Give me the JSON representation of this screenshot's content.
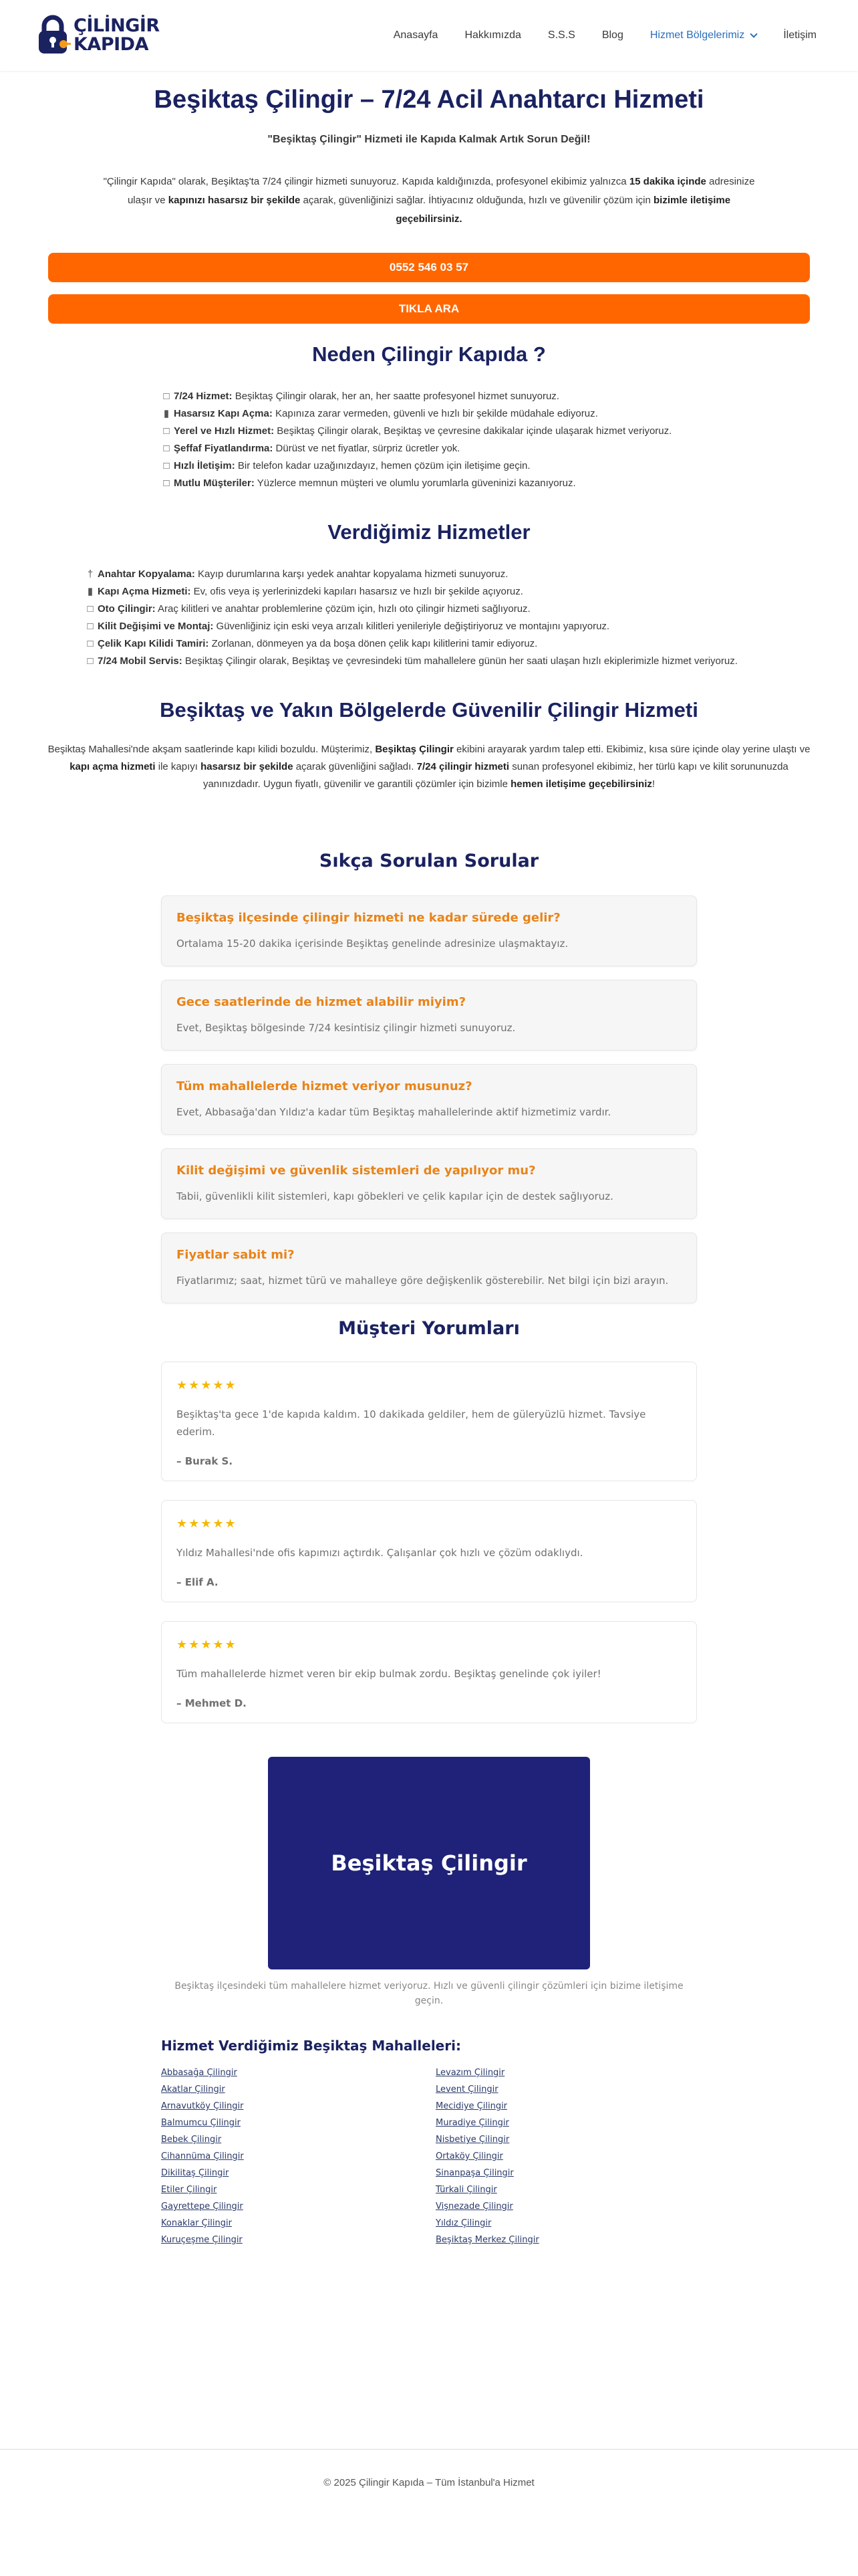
{
  "header": {
    "logo_line1": "ÇİLİNGİR",
    "logo_line2": "KAPIDA",
    "nav": [
      {
        "label": "Anasayfa"
      },
      {
        "label": "Hakkımızda"
      },
      {
        "label": "S.S.S"
      },
      {
        "label": "Blog"
      },
      {
        "label": "Hizmet Bölgelerimiz"
      },
      {
        "label": "İletişim"
      }
    ]
  },
  "hero": {
    "title": "Beşiktaş Çilingir – 7/24 Acil Anahtarcı Hizmeti",
    "subtitle": "\"Beşiktaş Çilingir\" Hizmeti ile Kapıda Kalmak Artık Sorun Değil!",
    "text_parts": [
      "\"Çilingir Kapıda\" olarak, Beşiktaş'ta 7/24 çilingir hizmeti sunuyoruz. Kapıda kaldığınızda, profesyonel ekibimiz yalnızca ",
      "15 dakika içinde",
      " adresinize ulaşır ve ",
      "kapınızı hasarsız bir şekilde",
      " açarak, güvenliğinizi sağlar. İhtiyacınız olduğunda, hızlı ve güvenilir çözüm için ",
      "bizimle iletişime geçebilirsiniz."
    ],
    "cta_phone": "0552 546 03 57",
    "cta_call": "TIKLA ARA"
  },
  "why": {
    "title": "Neden Çilingir Kapıda ?",
    "items": [
      {
        "icon": "box",
        "bold": "7/24 Hizmet:",
        "text": " Beşiktaş Çilingir olarak, her an, her saatte profesyonel hizmet sunuyoruz."
      },
      {
        "icon": "door",
        "bold": "Hasarsız Kapı Açma:",
        "text": " Kapınıza zarar vermeden, güvenli ve hızlı bir şekilde müdahale ediyoruz."
      },
      {
        "icon": "box",
        "bold": "Yerel ve Hızlı Hizmet:",
        "text": " Beşiktaş Çilingir olarak, Beşiktaş ve çevresine dakikalar içinde ulaşarak hizmet veriyoruz."
      },
      {
        "icon": "box",
        "bold": "Şeffaf Fiyatlandırma:",
        "text": " Dürüst ve net fiyatlar, sürpriz ücretler yok."
      },
      {
        "icon": "box",
        "bold": "Hızlı İletişim:",
        "text": " Bir telefon kadar uzağınızdayız, hemen çözüm için iletişime geçin."
      },
      {
        "icon": "box",
        "bold": "Mutlu Müşteriler:",
        "text": " Yüzlerce memnun müşteri ve olumlu yorumlarla güveninizi kazanıyoruz."
      }
    ]
  },
  "services": {
    "title": "Verdiğimiz Hizmetler",
    "items": [
      {
        "icon": "pin",
        "bold": "Anahtar Kopyalama:",
        "text": " Kayıp durumlarına karşı yedek anahtar kopyalama hizmeti sunuyoruz."
      },
      {
        "icon": "door",
        "bold": "Kapı Açma Hizmeti:",
        "text": " Ev, ofis veya iş yerlerinizdeki kapıları hasarsız ve hızlı bir şekilde açıyoruz."
      },
      {
        "icon": "box",
        "bold": "Oto Çilingir:",
        "text": " Araç kilitleri ve anahtar problemlerine çözüm için, hızlı oto çilingir hizmeti sağlıyoruz."
      },
      {
        "icon": "box",
        "bold": "Kilit Değişimi ve Montaj:",
        "text": " Güvenliğiniz için eski veya arızalı kilitleri yenileriyle değiştiriyoruz ve montajını yapıyoruz."
      },
      {
        "icon": "box",
        "bold": "Çelik Kapı Kilidi Tamiri:",
        "text": " Zorlanan, dönmeyen ya da boşa dönen çelik kapı kilitlerini tamir ediyoruz."
      },
      {
        "icon": "box",
        "bold": "7/24 Mobil Servis:",
        "text": " Beşiktaş Çilingir olarak, Beşiktaş ve çevresindeki tüm mahallelere günün her saati ulaşan hızlı ekiplerimizle hizmet veriyoruz."
      }
    ]
  },
  "regions": {
    "title": "Beşiktaş ve Yakın Bölgelerde Güvenilir Çilingir Hizmeti",
    "text_parts": [
      "Beşiktaş Mahallesi'nde akşam saatlerinde kapı kilidi bozuldu. Müşterimiz, ",
      "Beşiktaş Çilingir",
      " ekibini arayarak yardım talep etti. Ekibimiz, kısa süre içinde olay yerine ulaştı ve ",
      "kapı açma hizmeti",
      " ile kapıyı ",
      "hasarsız bir şekilde",
      " açarak güvenliğini sağladı. ",
      "7/24 çilingir hizmeti",
      " sunan profesyonel ekibimiz, her türlü kapı ve kilit sorununuzda yanınızdadır. Uygun fiyatlı, güvenilir ve garantili çözümler için bizimle ",
      "hemen iletişime geçebilirsiniz",
      "!"
    ]
  },
  "faq": {
    "title": "Sıkça Sorulan Sorular",
    "items": [
      {
        "q": "Beşiktaş ilçesinde çilingir hizmeti ne kadar sürede gelir?",
        "a": "Ortalama 15-20 dakika içerisinde Beşiktaş genelinde adresinize ulaşmaktayız."
      },
      {
        "q": "Gece saatlerinde de hizmet alabilir miyim?",
        "a": "Evet, Beşiktaş bölgesinde 7/24 kesintisiz çilingir hizmeti sunuyoruz."
      },
      {
        "q": "Tüm mahallelerde hizmet veriyor musunuz?",
        "a": "Evet, Abbasağa'dan Yıldız'a kadar tüm Beşiktaş mahallelerinde aktif hizmetimiz vardır."
      },
      {
        "q": "Kilit değişimi ve güvenlik sistemleri de yapılıyor mu?",
        "a": "Tabii, güvenlikli kilit sistemleri, kapı göbekleri ve çelik kapılar için de destek sağlıyoruz."
      },
      {
        "q": "Fiyatlar sabit mi?",
        "a": "Fiyatlarımız; saat, hizmet türü ve mahalleye göre değişkenlik gösterebilir. Net bilgi için bizi arayın."
      }
    ]
  },
  "reviews": {
    "title": "Müşteri Yorumları",
    "items": [
      {
        "stars": "★★★★★",
        "rating": 5,
        "text": "Beşiktaş'ta gece 1'de kapıda kaldım. 10 dakikada geldiler, hem de güleryüzlü hizmet. Tavsiye ederim.",
        "author": "– Burak S."
      },
      {
        "stars": "★★★★★",
        "rating": 5,
        "text": "Yıldız Mahallesi'nde ofis kapımızı açtırdık. Çalışanlar çok hızlı ve çözüm odaklıydı.",
        "author": "– Elif A."
      },
      {
        "stars": "★★★★★",
        "rating": 5,
        "text": "Tüm mahallelerde hizmet veren bir ekip bulmak zordu. Beşiktaş genelinde çok iyiler!",
        "author": "– Mehmet D."
      }
    ]
  },
  "banner": {
    "title": "Beşiktaş Çilingir",
    "bg_color": "#1f2278",
    "caption": "Beşiktaş ilçesindeki tüm mahallelere hizmet veriyoruz. Hızlı ve güvenli çilingir çözümleri için bizime iletişime geçin."
  },
  "neighborhoods": {
    "title": "Hizmet Verdiğimiz Beşiktaş Mahalleleri:",
    "left": [
      "Abbasağa Çilingir",
      "Akatlar Çilingir",
      "Arnavutköy Çilingir",
      "Balmumcu Çilingir",
      "Bebek Çilingir",
      "Cihannüma Çilingir",
      "Dikilitaş Çilingir",
      "Etiler Çilingir",
      "Gayrettepe Çilingir",
      "Konaklar Çilingir",
      "Kuruçeşme Çilingir"
    ],
    "right": [
      "Levazım Çilingir",
      "Levent Çilingir",
      "Mecidiye Çilingir",
      "Muradiye Çilingir",
      "Nisbetiye Çilingir",
      "Ortaköy Çilingir",
      "Sinanpaşa Çilingir",
      "Türkali Çilingir",
      "Vişnezade Çilingir",
      "Yıldız Çilingir",
      "Beşiktaş Merkez Çilingir"
    ]
  },
  "footer": {
    "text": "© 2025 Çilingir Kapıda – Tüm İstanbul'a Hizmet"
  },
  "colors": {
    "brand_navy": "#1a2260",
    "cta_orange": "#ff6600",
    "faq_question": "#e8841a",
    "star_gold": "#f5b800",
    "nav_active": "#2a6ebc"
  }
}
